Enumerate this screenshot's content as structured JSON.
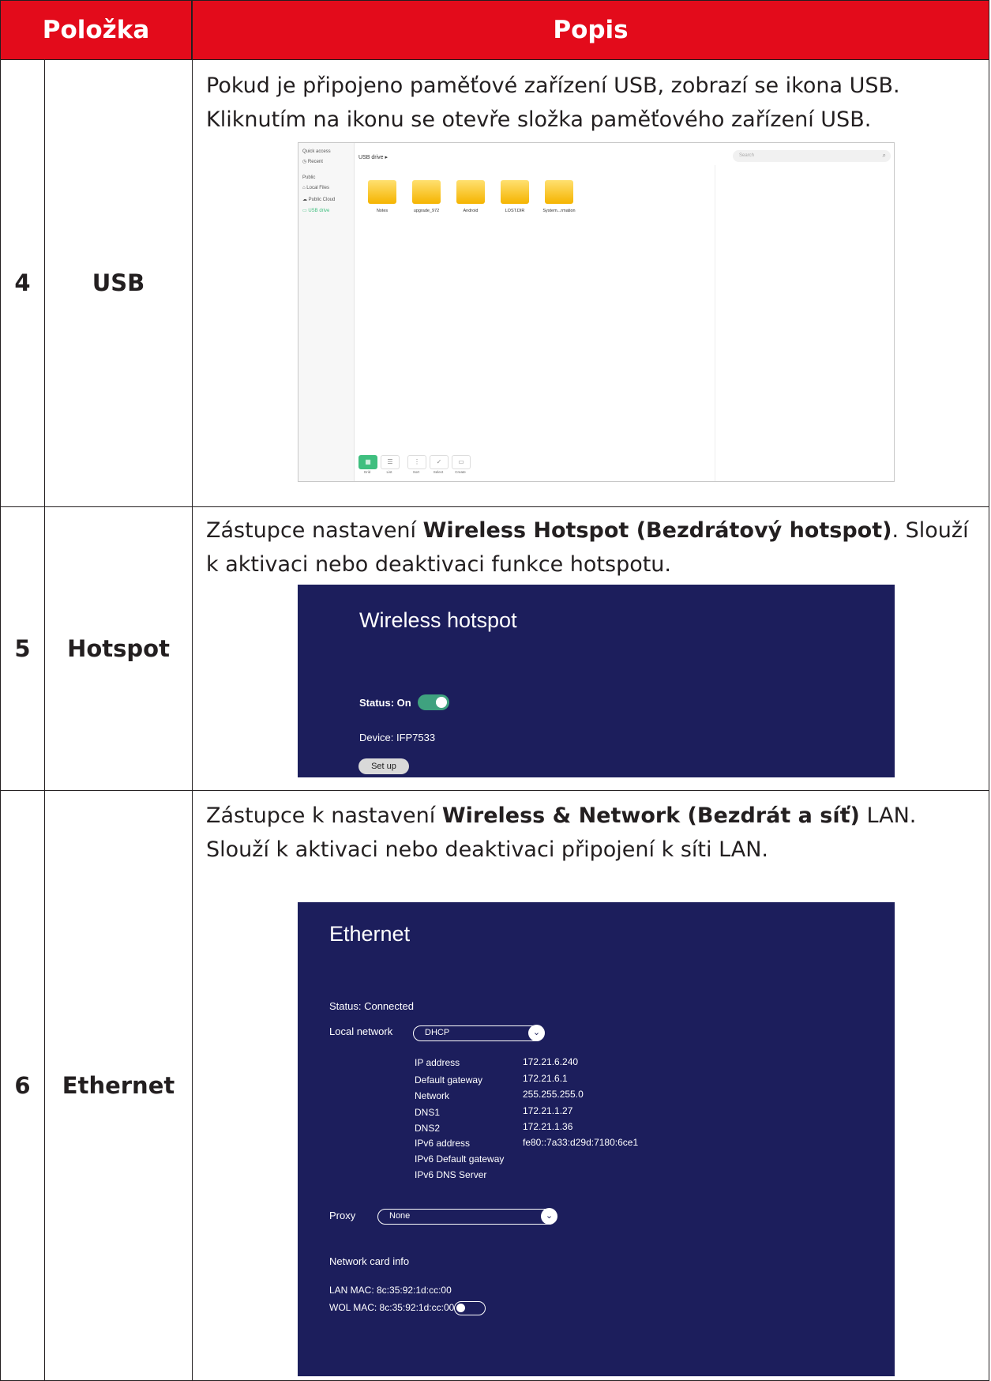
{
  "header": {
    "col1": "Položka",
    "col2": "Popis"
  },
  "rows": [
    {
      "num": "4",
      "item": "USB",
      "desc": "Pokud je připojeno paměťové zařízení USB, zobrazí se ikona USB. Kliknutím na ikonu se otevře složka paměťového zařízení USB."
    },
    {
      "num": "5",
      "item": "Hotspot",
      "desc_pre": "Zástupce nastavení ",
      "desc_bold": "Wireless Hotspot (Bezdrátový hotspot)",
      "desc_post": ". Slouží k aktivaci nebo deaktivaci funkce hotspotu."
    },
    {
      "num": "6",
      "item": "Ethernet",
      "desc_pre": "Zástupce k nastavení ",
      "desc_bold": "Wireless & Network (Bezdrát a síť)",
      "desc_post": " LAN. Slouží k aktivaci nebo deaktivaci připojení k síti LAN."
    }
  ],
  "usb_screen": {
    "quick_access": "Quick access",
    "recent": "Recent",
    "public": "Public",
    "local_files": "Local Files",
    "public_cloud": "Public Cloud",
    "usb_drive": "USB drive",
    "breadcrumb": "USB drive ▸",
    "search_placeholder": "Search",
    "folders": [
      "Notes",
      "upgrade_972",
      "Android",
      "LOST.DIR",
      "System...rmation"
    ],
    "tools": [
      "Grid",
      "List",
      "Sort",
      "Select",
      "Create"
    ]
  },
  "hotspot_screen": {
    "title": "Wireless hotspot",
    "status": "Status: On",
    "device": "Device:  IFP7533",
    "setup": "Set up"
  },
  "ethernet_screen": {
    "title": "Ethernet",
    "status": "Status: Connected",
    "local_network_label": "Local network",
    "local_network_value": "DHCP",
    "fields": [
      {
        "k": "IP address",
        "v": "172.21.6.240"
      },
      {
        "k": "Default gateway",
        "v": "172.21.6.1"
      },
      {
        "k": "Network",
        "v": "255.255.255.0"
      },
      {
        "k": "DNS1",
        "v": "172.21.1.27"
      },
      {
        "k": "DNS2",
        "v": "172.21.1.36"
      },
      {
        "k": "IPv6 address",
        "v": "fe80::7a33:d29d:7180:6ce1"
      },
      {
        "k": "IPv6 Default gateway",
        "v": ""
      },
      {
        "k": "IPv6 DNS Server",
        "v": ""
      }
    ],
    "proxy_label": "Proxy",
    "proxy_value": "None",
    "network_card_info": "Network card info",
    "lan_mac": "LAN MAC: 8c:35:92:1d:cc:00",
    "wol_mac": "WOL MAC: 8c:35:92:1d:cc:00"
  }
}
